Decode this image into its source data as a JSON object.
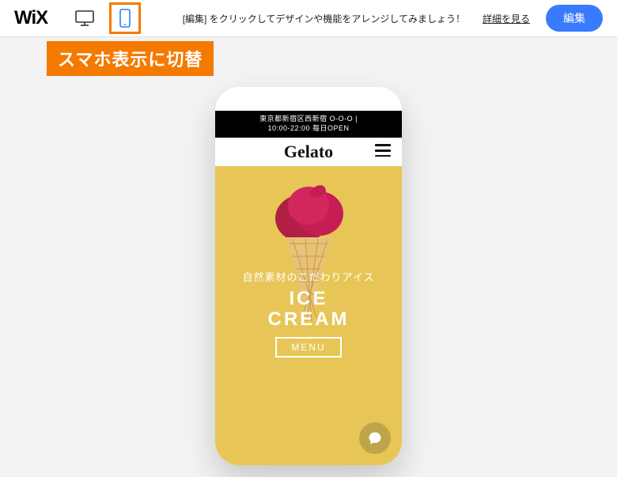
{
  "topbar": {
    "logo": "WiX",
    "tip": "[編集] をクリックしてデザインや機能をアレンジしてみましょう！",
    "detailsLink": "詳細を見る",
    "editButton": "編集"
  },
  "annotationLabel": "スマホ表示に切替",
  "phone": {
    "topInfo": {
      "line1": "東京都新宿区西新宿 O-O-O  |",
      "line2": "10:00-22:00  毎日OPEN"
    },
    "brand": "Gelato",
    "hero": {
      "jpTagline": "自然素材のこだわりアイス",
      "titleLine1": "ICE",
      "titleLine2": "CREAM",
      "menuButton": "MENU"
    }
  },
  "iconNames": {
    "desktop": "desktop-icon",
    "mobile": "mobile-icon",
    "burger": "hamburger-icon",
    "chat": "chat-icon"
  }
}
